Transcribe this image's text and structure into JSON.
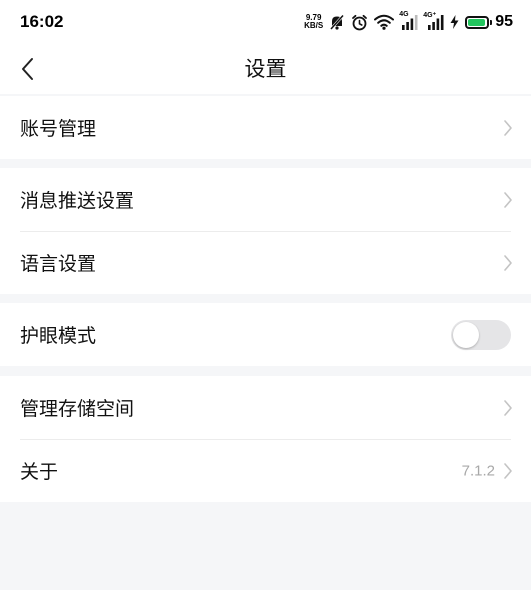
{
  "status_bar": {
    "time": "16:02",
    "net_speed_value": "9.79",
    "net_speed_unit": "KB/S",
    "sim1_tag": "4G",
    "sim2_tag": "4G⁺",
    "battery_level": "95",
    "battery_color": "#22c55e"
  },
  "nav": {
    "title": "设置",
    "back_icon": "chevron-left-icon"
  },
  "sections": [
    {
      "items": [
        {
          "label": "账号管理",
          "accessory": "chevron"
        }
      ]
    },
    {
      "items": [
        {
          "label": "消息推送设置",
          "accessory": "chevron"
        },
        {
          "label": "语言设置",
          "accessory": "chevron"
        }
      ]
    },
    {
      "items": [
        {
          "label": "护眼模式",
          "accessory": "toggle",
          "toggle_on": false
        }
      ]
    },
    {
      "items": [
        {
          "label": "管理存储空间",
          "accessory": "chevron"
        },
        {
          "label": "关于",
          "accessory": "chevron",
          "value": "7.1.2"
        }
      ]
    }
  ]
}
